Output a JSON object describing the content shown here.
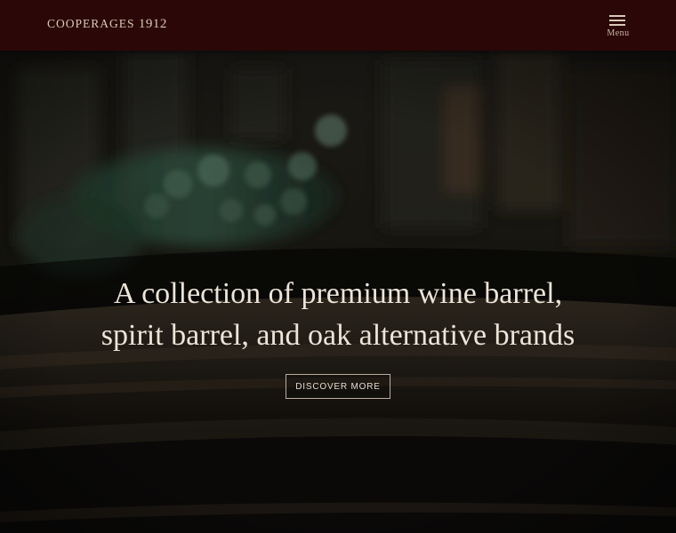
{
  "header": {
    "brand_name": "COOPERAGES",
    "brand_year": "1912",
    "menu_label": "Menu",
    "menu_icon": "hamburger-icon",
    "background_color": "#2b0707"
  },
  "hero": {
    "headline": "A collection of premium wine barrel, spirit barrel, and oak alternative brands",
    "cta_label": "DISCOVER MORE",
    "image_subject": "barrel-cellar-photo"
  }
}
